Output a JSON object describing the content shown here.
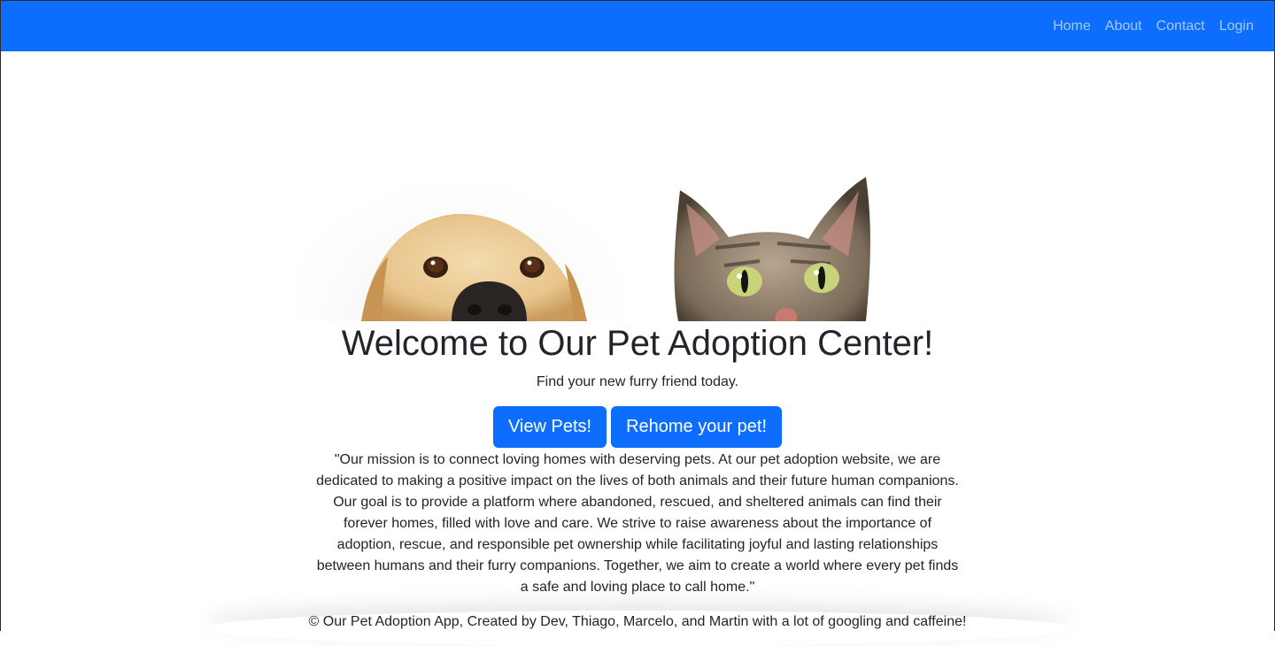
{
  "nav": {
    "links": [
      "Home",
      "About",
      "Contact",
      "Login"
    ]
  },
  "hero": {
    "title": "Welcome to Our Pet Adoption Center!",
    "subtitle": "Find your new furry friend today.",
    "image": "dog-and-cat-peeking-photo"
  },
  "buttons": {
    "view_pets": "View Pets!",
    "rehome": "Rehome your pet!"
  },
  "mission": "\"Our mission is to connect loving homes with deserving pets. At our pet adoption website, we are dedicated to making a positive impact on the lives of both animals and their future human companions. Our goal is to provide a platform where abandoned, rescued, and sheltered animals can find their forever homes, filled with love and care. We strive to raise awareness about the importance of adoption, rescue, and responsible pet ownership while facilitating joyful and lasting relationships between humans and their furry companions. Together, we aim to create a world where every pet finds a safe and loving place to call home.\"",
  "footer": "© Our Pet Adoption App, Created by Dev, Thiago, Marcelo, and Martin with a lot of googling and caffeine!",
  "colors": {
    "primary": "#0d6efd",
    "text": "#212529",
    "nav_link": "rgba(255,255,255,0.62)"
  }
}
